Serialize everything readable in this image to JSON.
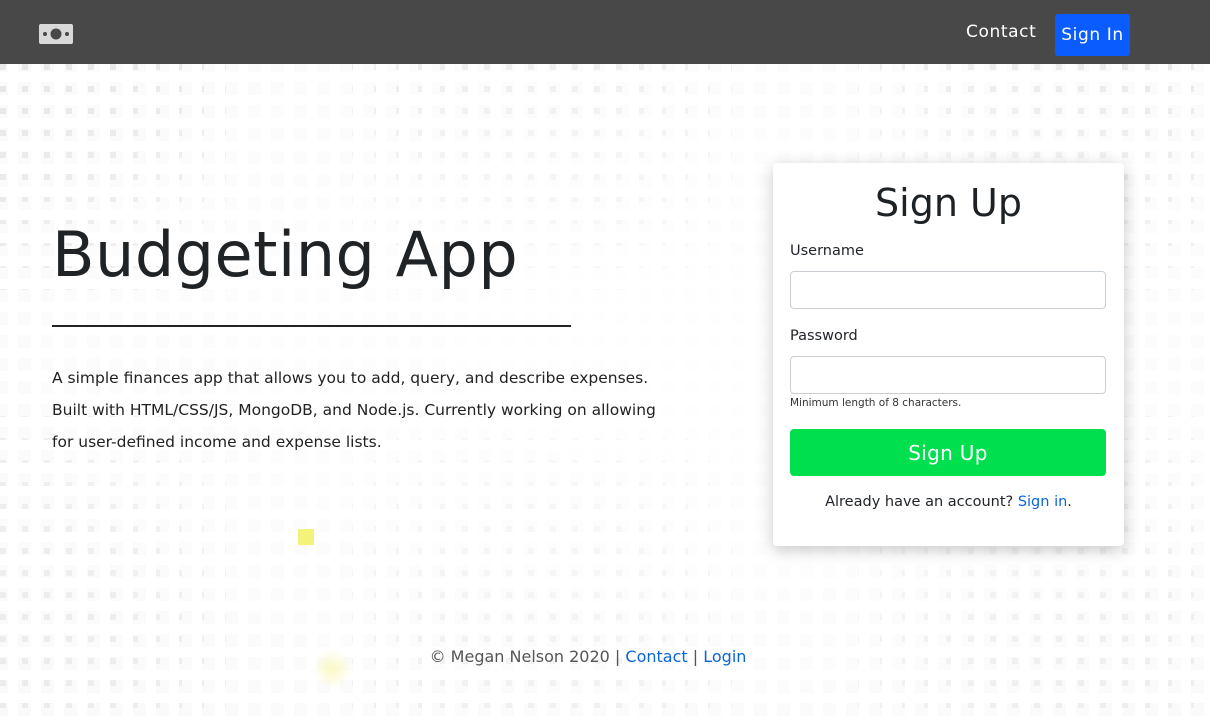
{
  "navbar": {
    "brand_icon": "money-bill-icon",
    "contact_label": "Contact",
    "signin_label": "Sign In"
  },
  "hero": {
    "title": "Budgeting App",
    "description": "A simple finances app that allows you to add, query, and describe expenses. Built with HTML/CSS/JS, MongoDB, and Node.js. Currently working on allowing for user-defined income and expense lists."
  },
  "signup": {
    "title": "Sign Up",
    "username_label": "Username",
    "username_value": "",
    "password_label": "Password",
    "password_value": "",
    "password_hint": "Minimum length of 8 characters.",
    "submit_label": "Sign Up",
    "already_text": "Already have an account?",
    "signin_link": "Sign in",
    "already_suffix": "."
  },
  "footer": {
    "copyright": "© Megan Nelson 2020 |",
    "contact_link": "Contact",
    "separator": "|",
    "login_link": "Login"
  },
  "colors": {
    "navbar_bg": "#484848",
    "primary": "#0a5cff",
    "signup_button": "#00e04e",
    "link": "#0a66d8"
  }
}
